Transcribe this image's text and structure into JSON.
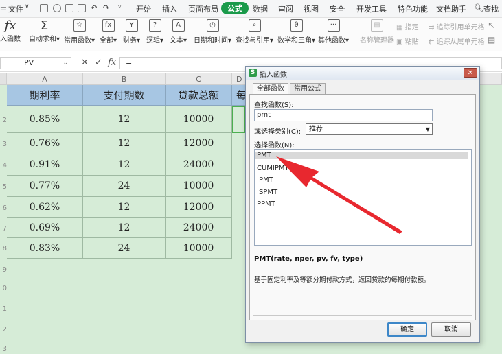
{
  "menubar": {
    "file": "文件",
    "items": [
      "开始",
      "插入",
      "页面布局",
      "公式",
      "数据",
      "审阅",
      "视图",
      "安全",
      "开发工具",
      "特色功能",
      "文档助手"
    ],
    "active": "公式",
    "search": "查找"
  },
  "ribbon": {
    "insert_fn": "插入函数",
    "autosum": "自动求和",
    "common": "常用函数",
    "all": "全部",
    "finance": "财务",
    "logic": "逻辑",
    "text": "文本",
    "datetime": "日期和时间",
    "lookup": "查找与引用",
    "math": "数学和三角",
    "other": "其他函数",
    "name_mgr": "名称管理器",
    "specify": "指定",
    "paste": "粘贴",
    "trace_prec": "追踪引用单元格",
    "trace_dep": "追踪从属单元格"
  },
  "formula_bar": {
    "name_box": "PV",
    "cancel": "✕",
    "confirm": "✓",
    "fx": "fx",
    "content": "="
  },
  "sheet": {
    "columns": [
      "A",
      "B",
      "C",
      "D"
    ],
    "headers": [
      "期利率",
      "支付期数",
      "贷款总额",
      "每"
    ],
    "rows": [
      [
        "0.85%",
        "12",
        "10000"
      ],
      [
        "0.76%",
        "12",
        "12000"
      ],
      [
        "0.91%",
        "12",
        "24000"
      ],
      [
        "0.77%",
        "24",
        "10000"
      ],
      [
        "0.62%",
        "12",
        "12000"
      ],
      [
        "0.69%",
        "12",
        "24000"
      ],
      [
        "0.83%",
        "24",
        "10000"
      ]
    ],
    "row_numbers": [
      "2",
      "3",
      "4",
      "5",
      "6",
      "7",
      "8",
      "9",
      "0",
      "1",
      "2",
      "3"
    ]
  },
  "dialog": {
    "title": "插入函数",
    "close": "✕",
    "tab_all": "全部函数",
    "tab_common": "常用公式",
    "search_label": "查找函数(S):",
    "search_value": "pmt",
    "category_label": "或选择类别(C):",
    "category_value": "推荐",
    "select_label": "选择函数(N):",
    "functions": [
      "PMT",
      "CUMIPMT",
      "IPMT",
      "ISPMT",
      "PPMT"
    ],
    "syntax": "PMT(rate, nper, pv, fv, type)",
    "description": "基于固定利率及等额分期付款方式，返回贷款的每期付款额。",
    "ok": "确定",
    "cancel": "取消"
  },
  "colors": {
    "accent": "#1a9a4a",
    "sheet_bg": "#d6ecd7",
    "header_fill": "#a7c6e3",
    "arrow": "#e8282f"
  }
}
